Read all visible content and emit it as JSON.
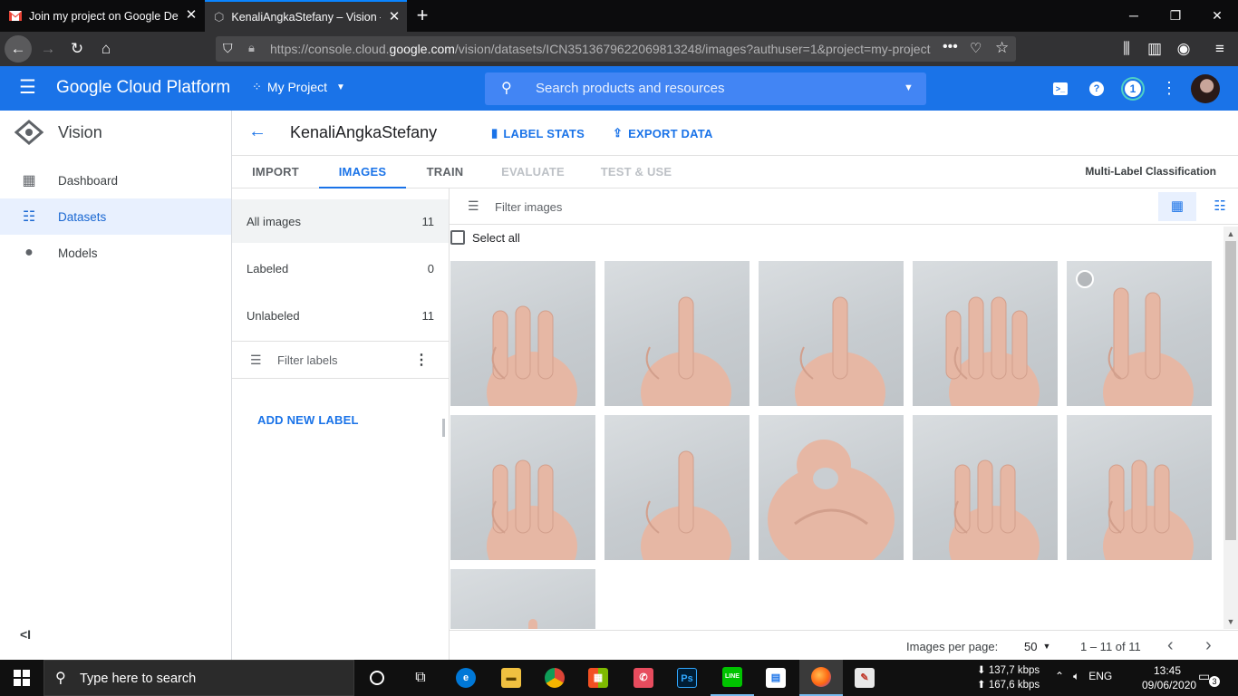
{
  "browser": {
    "tabs": [
      {
        "title": "Join my project on Google Dev",
        "icon": "gmail-icon",
        "active": false
      },
      {
        "title": "KenaliAngkaStefany – Vision –",
        "icon": "gcp-icon",
        "active": true
      }
    ],
    "url_prefix": "https://console.cloud.",
    "url_domain": "google.com",
    "url_suffix": "/vision/datasets/ICN3513679622069813248/images?authuser=1&project=my-project"
  },
  "gcp": {
    "brand": "Google Cloud Platform",
    "project": "My Project",
    "search_placeholder": "Search products and resources",
    "notification_count": "1",
    "brand_color": "#1a73e8"
  },
  "leftnav": {
    "title": "Vision",
    "items": [
      {
        "label": "Dashboard",
        "icon": "dashboard-icon",
        "active": false
      },
      {
        "label": "Datasets",
        "icon": "list-icon",
        "active": true
      },
      {
        "label": "Models",
        "icon": "lightbulb-icon",
        "active": false
      }
    ],
    "collapse": "<I"
  },
  "dataset": {
    "name": "KenaliAngkaStefany",
    "label_stats": "LABEL STATS",
    "export_data": "EXPORT DATA",
    "type": "Multi-Label Classification"
  },
  "tabs": [
    {
      "label": "IMPORT",
      "state": "normal"
    },
    {
      "label": "IMAGES",
      "state": "active"
    },
    {
      "label": "TRAIN",
      "state": "normal"
    },
    {
      "label": "EVALUATE",
      "state": "disabled"
    },
    {
      "label": "TEST & USE",
      "state": "disabled"
    }
  ],
  "filters": [
    {
      "label": "All images",
      "count": "11",
      "active": true
    },
    {
      "label": "Labeled",
      "count": "0",
      "active": false
    },
    {
      "label": "Unlabeled",
      "count": "11",
      "active": false
    }
  ],
  "filter_labels_placeholder": "Filter labels",
  "add_new_label": "ADD NEW LABEL",
  "filter_images_placeholder": "Filter images",
  "select_all": "Select all",
  "images": [
    {
      "gesture": "three-fingers"
    },
    {
      "gesture": "one-finger"
    },
    {
      "gesture": "one-finger"
    },
    {
      "gesture": "four-fingers"
    },
    {
      "gesture": "two-fingers"
    },
    {
      "gesture": "three-fingers"
    },
    {
      "gesture": "one-finger"
    },
    {
      "gesture": "zero-circle"
    },
    {
      "gesture": "three-fingers"
    },
    {
      "gesture": "three-fingers"
    },
    {
      "gesture": "partial"
    }
  ],
  "pagination": {
    "per_page_label": "Images per page:",
    "per_page": "50",
    "range": "1 – 11 of 11"
  },
  "taskbar": {
    "search_placeholder": "Type here to search",
    "net_down": "137,7 kbps",
    "net_up": "167,6 kbps",
    "lang": "ENG",
    "time": "13:45",
    "date": "09/06/2020",
    "notifications": "3"
  }
}
